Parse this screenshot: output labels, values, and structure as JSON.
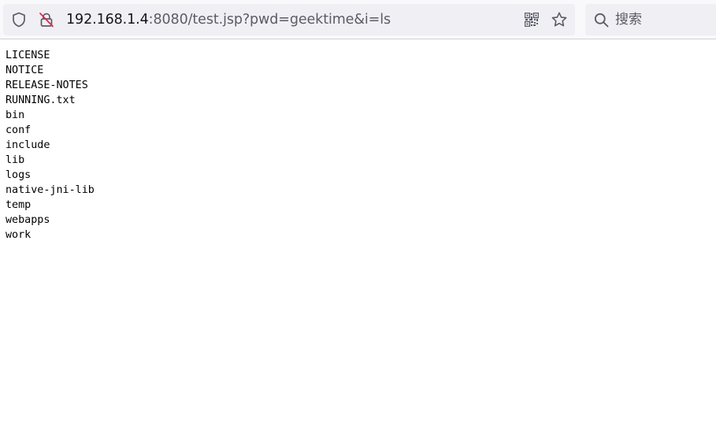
{
  "browser": {
    "url_host": "192.168.1.4",
    "url_rest": ":8080/test.jsp?pwd=geektime&i=ls",
    "search_placeholder": "搜索",
    "icons": {
      "shield": "shield-icon",
      "connection_not_secure": "not-secure-lock-icon",
      "qr_code": "qr-code-icon",
      "bookmark": "bookmark-star-icon",
      "search": "search-icon"
    }
  },
  "page": {
    "lines": [
      "LICENSE",
      "NOTICE",
      "RELEASE-NOTES",
      "RUNNING.txt",
      "bin",
      "conf",
      "include",
      "lib",
      "logs",
      "native-jni-lib",
      "temp",
      "webapps",
      "work"
    ]
  }
}
